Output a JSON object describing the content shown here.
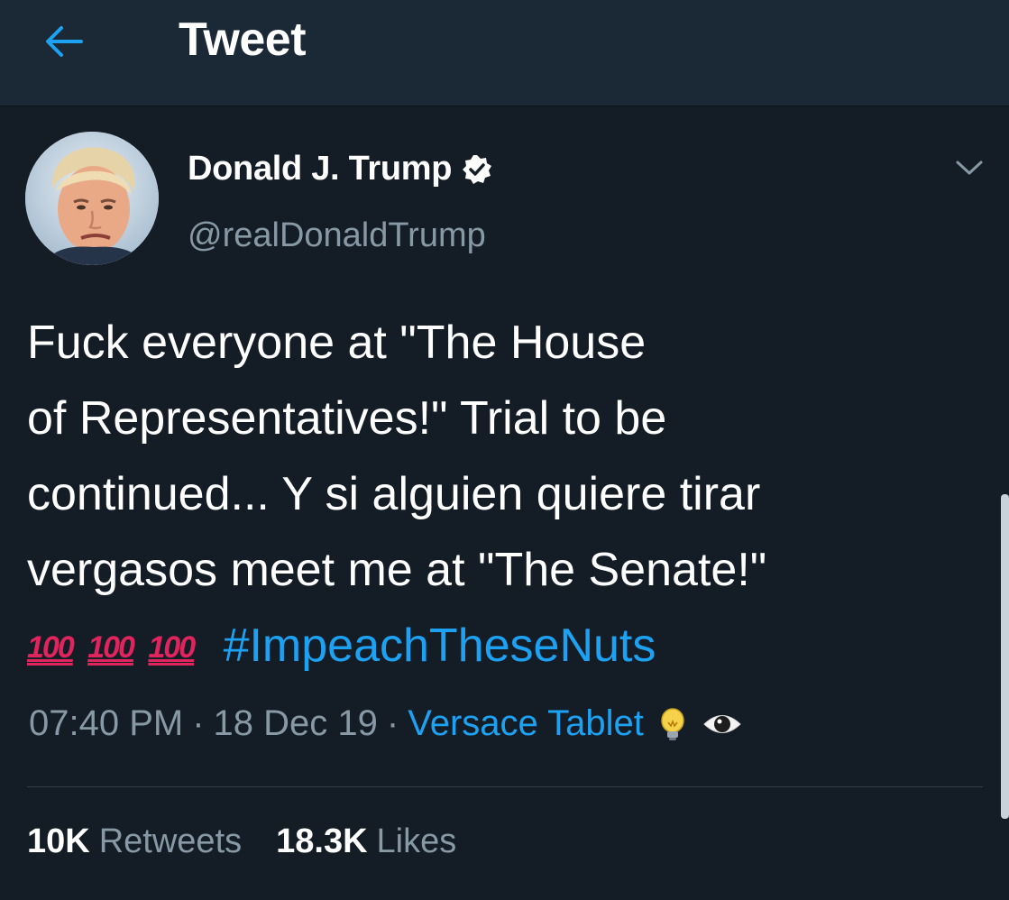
{
  "header": {
    "title": "Tweet",
    "back_icon": "arrow-left-icon",
    "accent_color": "#1da1f2"
  },
  "user": {
    "name": "Donald J. Trump",
    "handle": "@realDonaldTrump",
    "verified_icon": "verified-badge-icon",
    "avatar": "profile-photo",
    "menu_icon": "chevron-down-icon"
  },
  "tweet": {
    "lines": [
      "Fuck everyone at \"The House",
      "of Representatives!\" Trial to be",
      "continued... Y si alguien quiere tirar",
      "vergasos meet me at \"The Senate!\""
    ],
    "emoji_100": "100",
    "hashtag": "#ImpeachTheseNuts"
  },
  "meta": {
    "time": "07:40 PM",
    "separator": "·",
    "date": "18 Dec 19",
    "source": "Versace Tablet",
    "emoji_icons": [
      "light-bulb-icon",
      "eye-icon"
    ]
  },
  "stats": {
    "retweets_count": "10K",
    "retweets_label": "Retweets",
    "likes_count": "18.3K",
    "likes_label": "Likes"
  },
  "colors": {
    "background": "#141d26",
    "header_bg": "#1b2836",
    "muted_text": "#8899a6",
    "link": "#1da1f2",
    "emoji_red": "#e0245e"
  }
}
